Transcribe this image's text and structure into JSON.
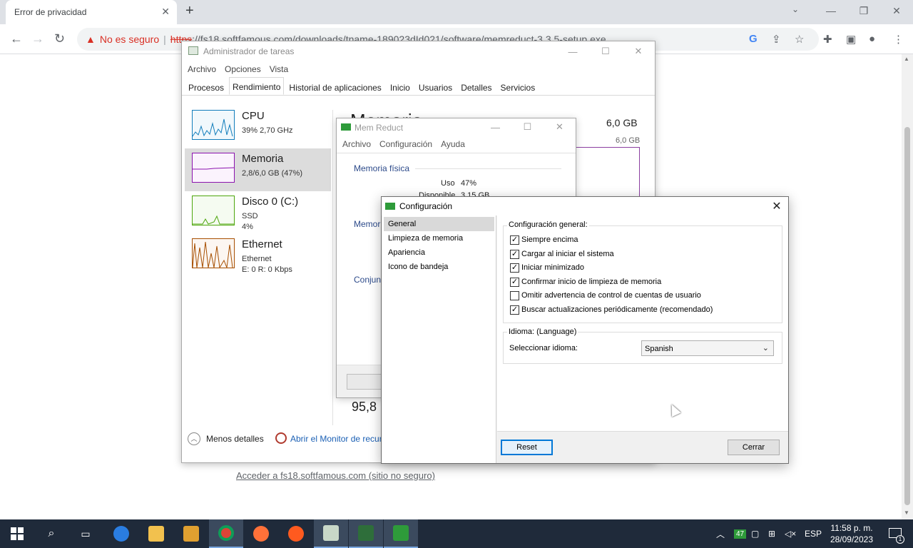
{
  "browser": {
    "tab_title": "Error de privacidad",
    "not_secure": "No es seguro",
    "url_scheme": "https",
    "url_rest": "://fs18.softfamous.com/downloads/tname-189023dId021/software/memreduct-3.3.5-setup.exe",
    "page_link": "Acceder a fs18.softfamous.com (sitio no seguro)"
  },
  "task_manager": {
    "title": "Administrador de tareas",
    "menu": [
      "Archivo",
      "Opciones",
      "Vista"
    ],
    "tabs": [
      "Procesos",
      "Rendimiento",
      "Historial de aplicaciones",
      "Inicio",
      "Usuarios",
      "Detalles",
      "Servicios"
    ],
    "active_tab": "Rendimiento",
    "resources": [
      {
        "name": "CPU",
        "line1": "39% 2,70 GHz",
        "line2": "",
        "color": "#117dbb"
      },
      {
        "name": "Memoria",
        "line1": "2,8/6,0 GB (47%)",
        "line2": "",
        "color": "#8b12ae"
      },
      {
        "name": "Disco 0 (C:)",
        "line1": "SSD",
        "line2": "4%",
        "color": "#4da60c"
      },
      {
        "name": "Ethernet",
        "line1": "Ethernet",
        "line2": "E: 0 R: 0 Kbps",
        "color": "#a74f01"
      }
    ],
    "heading_partial": "Memoria",
    "total": "6,0 GB",
    "total_small": "6,0 GB",
    "big_number": "95,8",
    "fewer_details": "Menos detalles",
    "open_monitor": "Abrir el Monitor de recursos"
  },
  "mem_reduct": {
    "title": "Mem Reduct",
    "menu": [
      "Archivo",
      "Configuración",
      "Ayuda"
    ],
    "group_physical": "Memoria física",
    "uso_label": "Uso",
    "uso_value": "47%",
    "disponible_label": "Disponible",
    "disponible_value": "3,15 GB",
    "fragment_1": "Memor",
    "fragment_2": "Conjun"
  },
  "config": {
    "title": "Configuración",
    "nav": [
      "General",
      "Limpieza de memoria",
      "Apariencia",
      "Icono de bandeja"
    ],
    "general_legend": "Configuración general:",
    "checks": [
      {
        "label": "Siempre encima",
        "checked": true
      },
      {
        "label": "Cargar al iniciar el sistema",
        "checked": true
      },
      {
        "label": "Iniciar minimizado",
        "checked": true
      },
      {
        "label": "Confirmar inicio de limpieza de memoria",
        "checked": true
      },
      {
        "label": "Omitir advertencia de control de cuentas de usuario",
        "checked": false
      },
      {
        "label": "Buscar actualizaciones periódicamente (recomendado)",
        "checked": true
      }
    ],
    "lang_legend": "Idioma: (Language)",
    "lang_label": "Seleccionar idioma:",
    "lang_value": "Spanish",
    "reset": "Reset",
    "close": "Cerrar"
  },
  "taskbar": {
    "tray_badge": "47",
    "lang": "ESP",
    "time": "11:58 p. m.",
    "date": "28/09/2023",
    "notifications": "1"
  }
}
